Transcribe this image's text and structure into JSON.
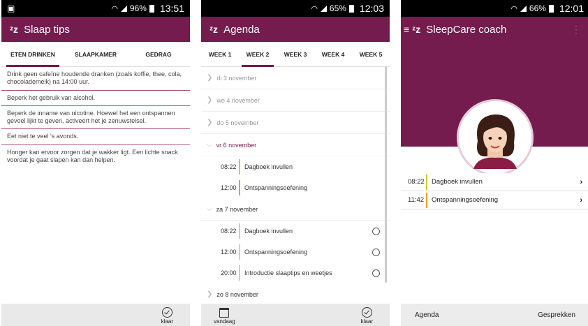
{
  "screen1": {
    "status": {
      "battery": "96%",
      "time": "13:51"
    },
    "title": "Slaap tips",
    "logo": "ᶻz",
    "tabs": [
      "ETEN DRINKEN",
      "SLAAPKAMER",
      "GEDRAG"
    ],
    "tips": [
      "Drink geen cafeïne houdende dranken (zoals koffie, thee, cola, chocolademelk) na 14:00 uur.",
      "Beperk het gebruik van alcohol.",
      "Beperk de inname van nicotine. Hoewel het een ontspannen gevoel lijkt te geven, activeert het je zenuwstelsel.",
      "Eet niet te veel 's avonds.",
      "Honger kan ervoor zorgen dat je wakker ligt. Een lichte snack voordat je gaat slapen kan dan helpen."
    ],
    "done_label": "klaar"
  },
  "screen2": {
    "status": {
      "battery": "65%",
      "time": "12:03"
    },
    "title": "Agenda",
    "logo": "ᶻz",
    "tabs": [
      "WEEK 1",
      "WEEK 2",
      "WEEK 3",
      "WEEK 4",
      "WEEK 5"
    ],
    "days": {
      "d3": "di 3 november",
      "d4": "wo 4 november",
      "d5": "do 5 november",
      "d6": "vr 6 november",
      "d7": "za 7 november",
      "d8": "zo 8 november"
    },
    "tasks6": [
      {
        "time": "08:22",
        "label": "Dagboek invullen",
        "color": "#c6d21a"
      },
      {
        "time": "12:00",
        "label": "Ontspanningsoefening",
        "color": "#f0a020"
      }
    ],
    "tasks7": [
      {
        "time": "08:22",
        "label": "Dagboek invullen"
      },
      {
        "time": "12:00",
        "label": "Ontspanningsoefening"
      },
      {
        "time": "20:00",
        "label": "Introductie slaaptips en weetjes"
      }
    ],
    "today_label": "vandaag",
    "done_label": "klaar"
  },
  "screen3": {
    "status": {
      "battery": "66%",
      "time": "12:01"
    },
    "title": "SleepCare coach",
    "logo": "ᶻz",
    "tasks": [
      {
        "time": "08:22",
        "label": "Dagboek invullen",
        "color": "#c6d21a"
      },
      {
        "time": "11:42",
        "label": "Ontspanningsoefening",
        "color": "#f0a020"
      }
    ],
    "footer_left": "Agenda",
    "footer_right": "Gesprekken"
  },
  "colors": {
    "brand": "#731c4d",
    "accent_green": "#c6d21a",
    "accent_orange": "#f0a020"
  }
}
